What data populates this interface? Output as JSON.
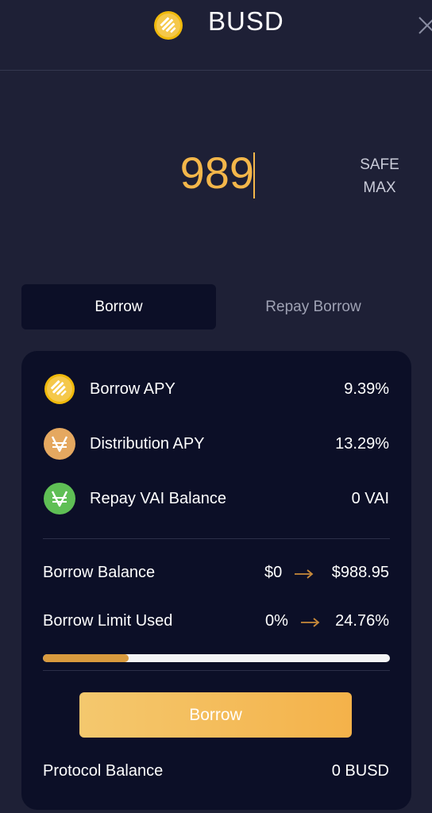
{
  "header": {
    "title": "BUSD",
    "token_icon": "busd-icon",
    "close_icon": "close-icon"
  },
  "amount": {
    "value": "989",
    "safe_max_line1": "SAFE",
    "safe_max_line2": "MAX"
  },
  "tabs": [
    {
      "label": "Borrow",
      "active": true
    },
    {
      "label": "Repay Borrow",
      "active": false
    }
  ],
  "stats": [
    {
      "icon": "busd-icon",
      "label": "Borrow APY",
      "value": "9.39%"
    },
    {
      "icon": "venus-distribution-icon",
      "label": "Distribution APY",
      "value": "13.29%"
    },
    {
      "icon": "vai-icon",
      "label": "Repay VAI Balance",
      "value": "0 VAI"
    }
  ],
  "borrow_balance": {
    "label": "Borrow Balance",
    "from": "$0",
    "to": "$988.95"
  },
  "borrow_limit": {
    "label": "Borrow Limit Used",
    "from": "0%",
    "to": "24.76%",
    "progress_fraction": 0.2476
  },
  "action": {
    "label": "Borrow"
  },
  "protocol_balance": {
    "label": "Protocol Balance",
    "value": "0 BUSD"
  },
  "colors": {
    "accent": "#f4b74a",
    "background": "#1e2036",
    "card": "#0c0f27",
    "busd": "#f0b90b",
    "distribution": "#e5a860",
    "vai": "#5fbf55"
  }
}
